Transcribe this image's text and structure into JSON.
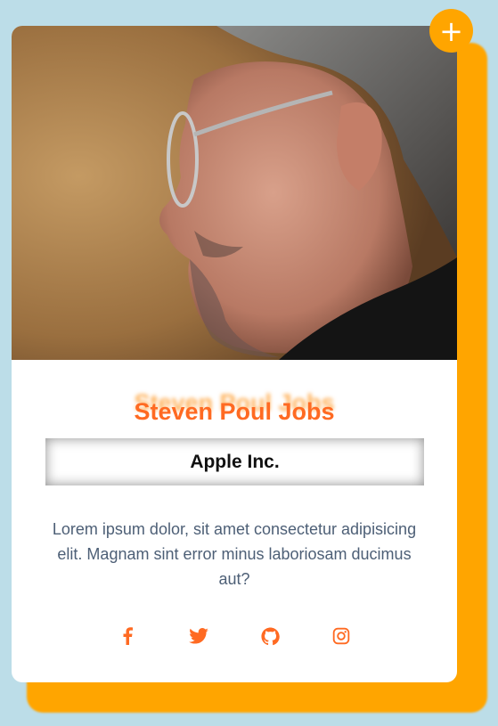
{
  "profile": {
    "name": "Steven Poul Jobs",
    "company": "Apple Inc.",
    "bio": "Lorem ipsum dolor, sit amet consectetur adipisicing elit. Magnam sint error minus laboriosam ducimus aut?",
    "add_label": "+"
  },
  "socials": [
    {
      "icon": "facebook-icon"
    },
    {
      "icon": "twitter-icon"
    },
    {
      "icon": "github-icon"
    },
    {
      "icon": "instagram-icon"
    }
  ],
  "colors": {
    "background": "#bcdde8",
    "accent": "#ffa500",
    "name": "#ff6a22",
    "bio_text": "#4d5f76"
  }
}
